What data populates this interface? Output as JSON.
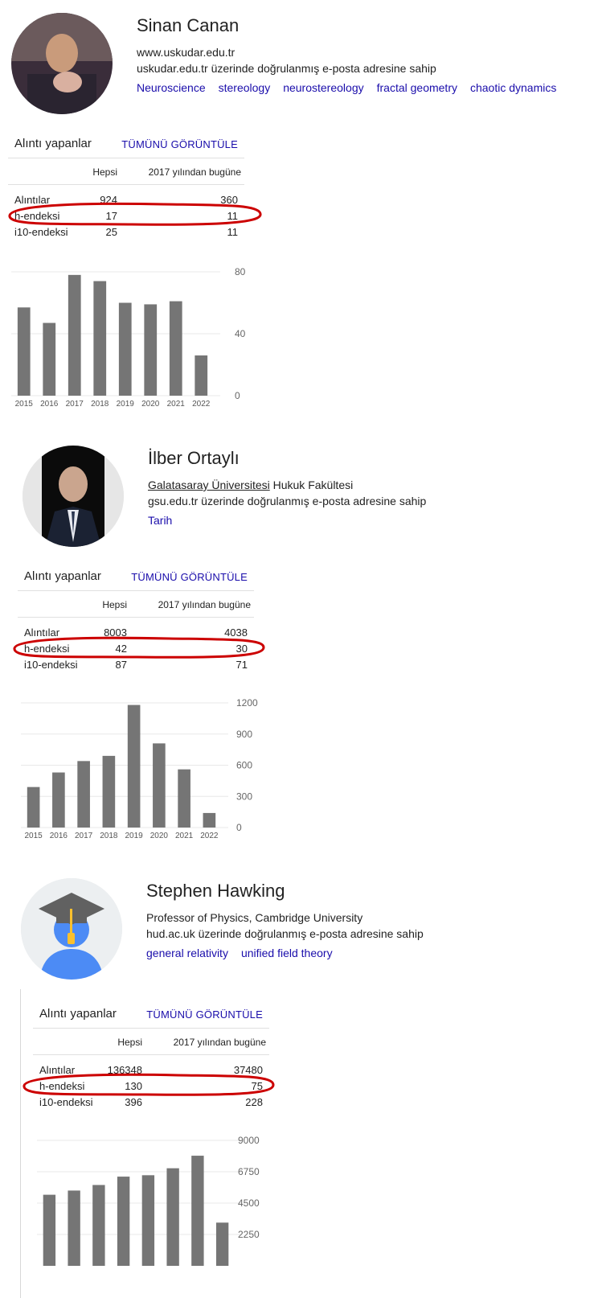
{
  "profiles": [
    {
      "name": "Sinan Canan",
      "lines": [
        "www.uskudar.edu.tr",
        "uskudar.edu.tr üzerinde doğrulanmış e-posta adresine sahip"
      ],
      "tags": [
        "Neuroscience",
        "stereology",
        "neurostereology",
        "fractal geometry",
        "chaotic dynamics"
      ],
      "cited_by_title": "Alıntı yapanlar",
      "view_all": "TÜMÜNÜ GÖRÜNTÜLE",
      "col_all": "Hepsi",
      "col_since": "2017 yılından bugüne",
      "rows": [
        {
          "label": "Alıntılar",
          "all": "924",
          "since": "360"
        },
        {
          "label": "h-endeksi",
          "all": "17",
          "since": "11"
        },
        {
          "label": "i10-endeksi",
          "all": "25",
          "since": "11"
        }
      ]
    },
    {
      "name": "İlber Ortaylı",
      "affiliation_link": "Galatasaray Üniversitesi",
      "affiliation_rest": " Hukuk Fakültesi",
      "lines": [
        "gsu.edu.tr üzerinde doğrulanmış e-posta adresine sahip"
      ],
      "tags": [
        "Tarih"
      ],
      "cited_by_title": "Alıntı yapanlar",
      "view_all": "TÜMÜNÜ GÖRÜNTÜLE",
      "col_all": "Hepsi",
      "col_since": "2017 yılından bugüne",
      "rows": [
        {
          "label": "Alıntılar",
          "all": "8003",
          "since": "4038"
        },
        {
          "label": "h-endeksi",
          "all": "42",
          "since": "30"
        },
        {
          "label": "i10-endeksi",
          "all": "87",
          "since": "71"
        }
      ]
    },
    {
      "name": "Stephen Hawking",
      "lines": [
        "Professor of Physics, Cambridge University",
        "hud.ac.uk üzerinde doğrulanmış e-posta adresine sahip"
      ],
      "tags": [
        "general relativity",
        "unified field theory"
      ],
      "cited_by_title": "Alıntı yapanlar",
      "view_all": "TÜMÜNÜ GÖRÜNTÜLE",
      "col_all": "Hepsi",
      "col_since": "2017 yılından bugüne",
      "rows": [
        {
          "label": "Alıntılar",
          "all": "136348",
          "since": "37480"
        },
        {
          "label": "h-endeksi",
          "all": "130",
          "since": "75"
        },
        {
          "label": "i10-endeksi",
          "all": "396",
          "since": "228"
        }
      ]
    }
  ],
  "colors": {
    "bar": "#757575",
    "grid": "#e8e8e8",
    "link": "#1a0dab",
    "highlight": "#cc0000"
  },
  "chart_data": [
    {
      "type": "bar",
      "categories": [
        "2015",
        "2016",
        "2017",
        "2018",
        "2019",
        "2020",
        "2021",
        "2022"
      ],
      "values": [
        57,
        47,
        78,
        74,
        60,
        59,
        61,
        26
      ],
      "yticks": [
        0,
        40,
        80
      ],
      "ylim": [
        0,
        80
      ]
    },
    {
      "type": "bar",
      "categories": [
        "2015",
        "2016",
        "2017",
        "2018",
        "2019",
        "2020",
        "2021",
        "2022"
      ],
      "values": [
        390,
        530,
        640,
        690,
        1180,
        810,
        560,
        140
      ],
      "yticks": [
        0,
        300,
        600,
        900,
        1200
      ],
      "ylim": [
        0,
        1200
      ]
    },
    {
      "type": "bar",
      "categories": [
        "2015",
        "2016",
        "2017",
        "2018",
        "2019",
        "2020",
        "2021",
        "2022"
      ],
      "values": [
        5100,
        5400,
        5800,
        6400,
        6500,
        7000,
        7900,
        3100
      ],
      "yticks": [
        2250,
        4500,
        6750,
        9000
      ],
      "ylim": [
        0,
        9000
      ]
    }
  ]
}
